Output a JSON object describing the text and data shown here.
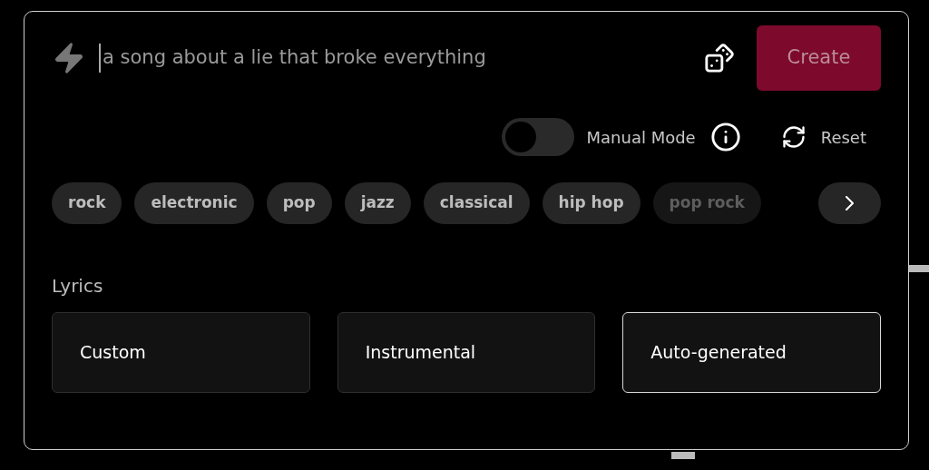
{
  "prompt": {
    "placeholder": "a song about a lie that broke everything"
  },
  "create_button": "Create",
  "manual_mode": {
    "label": "Manual Mode",
    "on": false
  },
  "reset_button": "Reset",
  "tags": [
    "rock",
    "electronic",
    "pop",
    "jazz",
    "classical",
    "hip hop",
    "pop rock"
  ],
  "lyrics": {
    "label": "Lyrics",
    "options": [
      {
        "label": "Custom",
        "selected": false
      },
      {
        "label": "Instrumental",
        "selected": false
      },
      {
        "label": "Auto-generated",
        "selected": true
      }
    ]
  }
}
